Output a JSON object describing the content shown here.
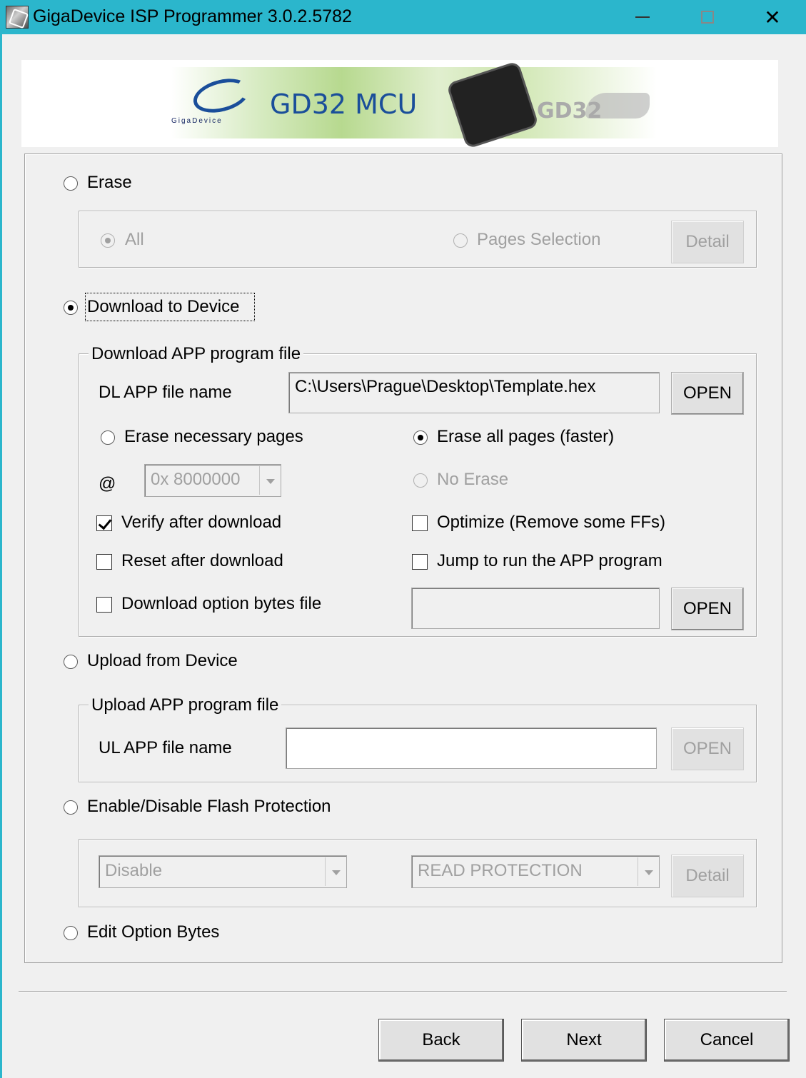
{
  "window": {
    "title": "GigaDevice ISP Programmer 3.0.2.5782",
    "minimize_icon": "minimize-icon",
    "maximize_icon": "maximize-icon",
    "close_icon": "close-icon",
    "close_glyph": "✕"
  },
  "banner": {
    "brand": "GigaDevice",
    "title": "GD32 MCU",
    "mascot_text": "GD32"
  },
  "erase": {
    "label": "Erase",
    "all_label": "All",
    "pages_label": "Pages Selection",
    "detail_label": "Detail"
  },
  "download": {
    "label": "Download to Device",
    "group_title": "Download APP program file",
    "file_label": "DL APP file name",
    "file_value": "C:\\Users\\Prague\\Desktop\\Template.hex",
    "open_label": "OPEN",
    "erase_necessary": "Erase necessary pages",
    "erase_all": "Erase all pages (faster)",
    "at_label": "@",
    "address_value": "0x 8000000",
    "no_erase": "No Erase",
    "verify": "Verify after download",
    "optimize": "Optimize (Remove some FFs)",
    "reset": "Reset after download",
    "jump": "Jump to run the APP program",
    "option_bytes": "Download option bytes file",
    "open2_label": "OPEN"
  },
  "upload": {
    "label": "Upload from Device",
    "group_title": "Upload APP program file",
    "file_label": "UL APP file name",
    "file_value": "",
    "open_label": "OPEN"
  },
  "protection": {
    "label": "Enable/Disable Flash Protection",
    "mode_value": "Disable",
    "type_value": "READ PROTECTION",
    "detail_label": "Detail"
  },
  "edit_option": {
    "label": "Edit Option Bytes"
  },
  "footer": {
    "back": "Back",
    "next": "Next",
    "cancel": "Cancel"
  }
}
